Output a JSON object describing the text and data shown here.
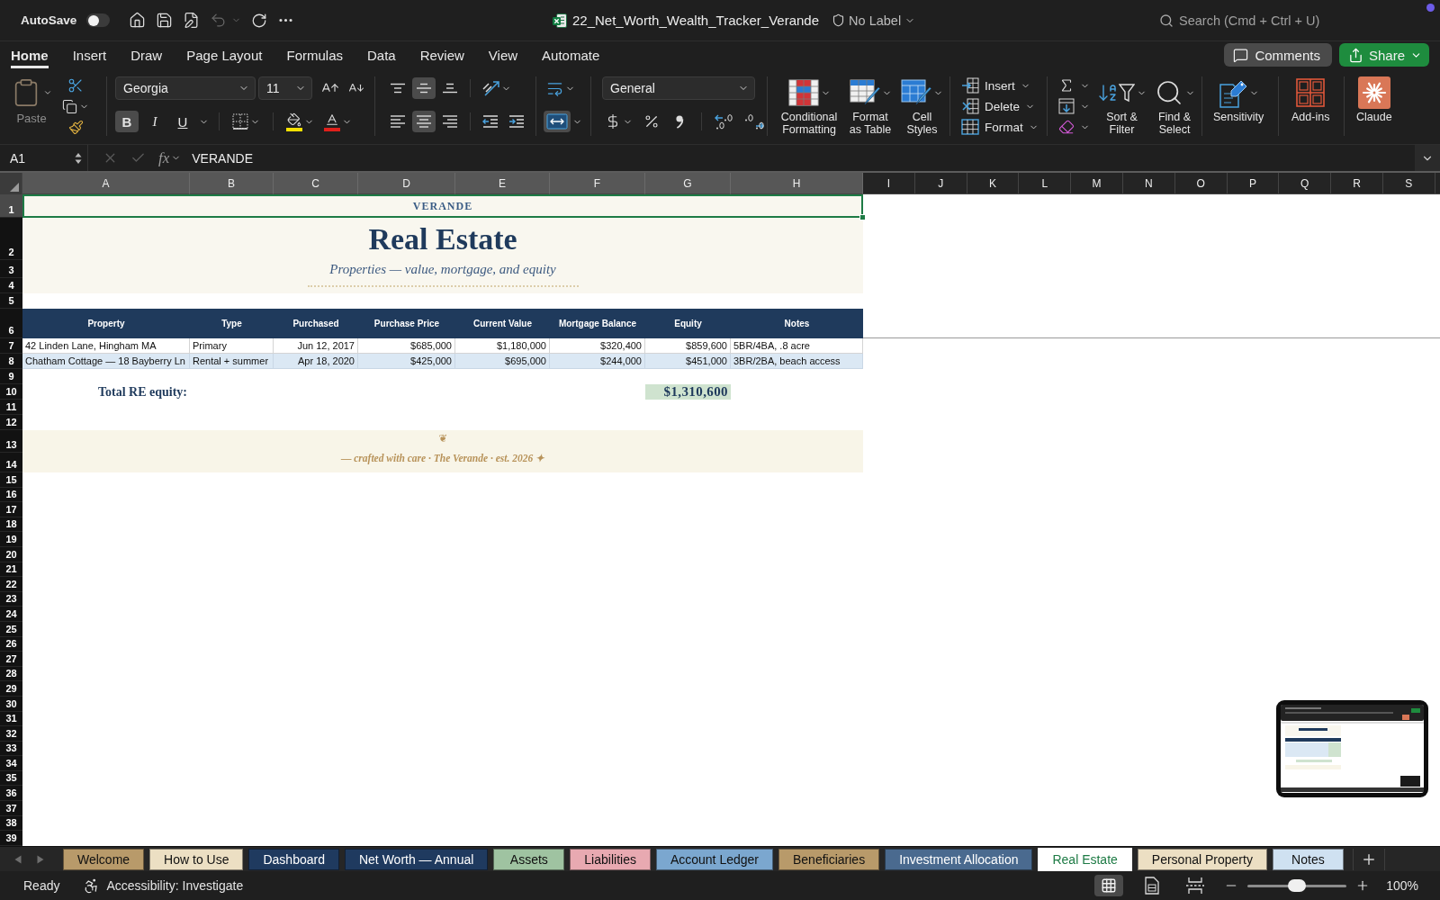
{
  "title_bar": {
    "autosave": {
      "label": "AutoSave",
      "on": false
    },
    "undo": {
      "disabled": true
    },
    "document_title": "22_Net_Worth_Wealth_Tracker_Verande",
    "sensitivity_label": "No Label",
    "search": {
      "placeholder": "Search (Cmd + Ctrl + U)"
    }
  },
  "ribbon": {
    "tabs": [
      {
        "label": "Home",
        "selected": true
      },
      {
        "label": "Insert",
        "selected": false
      },
      {
        "label": "Draw",
        "selected": false
      },
      {
        "label": "Page Layout",
        "selected": false
      },
      {
        "label": "Formulas",
        "selected": false
      },
      {
        "label": "Data",
        "selected": false
      },
      {
        "label": "Review",
        "selected": false
      },
      {
        "label": "View",
        "selected": false
      },
      {
        "label": "Automate",
        "selected": false
      }
    ],
    "comments_button": "Comments",
    "share_button": "Share",
    "paste": {
      "label": "Paste",
      "disabled": true
    },
    "font": {
      "name": "Georgia",
      "size": "11"
    },
    "text_styles": [
      {
        "kind": "bold",
        "label": "B",
        "on": true
      },
      {
        "kind": "italic",
        "label": "I",
        "on": false
      },
      {
        "kind": "underline",
        "label": "U",
        "on": false
      }
    ],
    "vertical_alignment": [
      {
        "kind": "top",
        "selected": false
      },
      {
        "kind": "middle",
        "selected": true
      },
      {
        "kind": "bottom",
        "selected": false
      }
    ],
    "horizontal_alignment": [
      {
        "kind": "left",
        "selected": false
      },
      {
        "kind": "center",
        "selected": true
      },
      {
        "kind": "right",
        "selected": false
      }
    ],
    "merge_and_center": {
      "on": true
    },
    "number_format": "General",
    "style_commands": [
      {
        "kind": "conditional_formatting",
        "label": "Conditional Formatting"
      },
      {
        "kind": "format_as_table",
        "label": "Format as Table"
      },
      {
        "kind": "cell_styles",
        "label": "Cell Styles"
      }
    ],
    "cell_commands": [
      {
        "kind": "insert",
        "label": "Insert"
      },
      {
        "kind": "delete",
        "label": "Delete"
      },
      {
        "kind": "format",
        "label": "Format"
      }
    ],
    "editing_commands": [
      {
        "kind": "sort_filter",
        "label": "Sort & Filter"
      },
      {
        "kind": "find_select",
        "label": "Find & Select"
      }
    ],
    "extra_commands": [
      {
        "kind": "sensitivity",
        "label": "Sensitivity"
      },
      {
        "kind": "add_ins",
        "label": "Add-ins"
      },
      {
        "kind": "claude",
        "label": "Claude"
      }
    ]
  },
  "formula_bar": {
    "name_box": "A1",
    "function_button": "fx",
    "formula": "VERANDE",
    "edit_buttons_disabled": true
  },
  "sheet": {
    "column_headers": [
      "A",
      "B",
      "C",
      "D",
      "E",
      "F",
      "G",
      "H",
      "I",
      "J",
      "K",
      "L",
      "M",
      "N",
      "O",
      "P",
      "Q",
      "R",
      "S"
    ],
    "row_numbers": [
      "1",
      "2",
      "3",
      "4",
      "5",
      "6",
      "7",
      "8",
      "9",
      "10",
      "11",
      "12",
      "13",
      "14",
      "15",
      "16",
      "17",
      "18",
      "19",
      "20",
      "21",
      "22",
      "23",
      "24",
      "25",
      "26",
      "27",
      "28",
      "29",
      "30",
      "31",
      "32",
      "33",
      "34",
      "35",
      "36",
      "37",
      "38",
      "39"
    ],
    "brand": {
      "text": "VERANDE",
      "selected": true
    },
    "title": "Real Estate",
    "subtitle": "Properties — value, mortgage, and equity",
    "table": {
      "columns": [
        "Property",
        "Type",
        "Purchased",
        "Purchase Price",
        "Current Value",
        "Mortgage Balance",
        "Equity",
        "Notes"
      ],
      "rows": [
        [
          "42 Linden Lane, Hingham MA",
          "Primary",
          "Jun 12, 2017",
          "$685,000",
          "$1,180,000",
          "$320,400",
          "$859,600",
          "5BR/4BA, .8 acre"
        ],
        [
          "Chatham Cottage — 18 Bayberry Ln",
          "Rental + summer",
          "Apr 18, 2020",
          "$425,000",
          "$695,000",
          "$244,000",
          "$451,000",
          "3BR/2BA, beach access"
        ]
      ]
    },
    "total": {
      "label": "Total RE equity:",
      "value": "$1,310,600"
    },
    "footer": {
      "ornament": "❦",
      "text": "— crafted with care · The Verande · est. 2026 ✦"
    }
  },
  "sheet_tabs": [
    {
      "label": "Welcome",
      "color": "#b89a6a",
      "selected": false
    },
    {
      "label": "How to Use",
      "color": "#ecdfc3",
      "selected": false
    },
    {
      "label": "Dashboard",
      "color": "#1f3a5f",
      "selected": false
    },
    {
      "label": "Net Worth — Annual",
      "color": "#1f3a5f",
      "selected": false
    },
    {
      "label": "Assets",
      "color": "#9fc3a1",
      "selected": false
    },
    {
      "label": "Liabilities",
      "color": "#e8a9b1",
      "selected": false
    },
    {
      "label": "Account Ledger",
      "color": "#7ba7cf",
      "selected": false
    },
    {
      "label": "Beneficiaries",
      "color": "#b89a6a",
      "selected": false
    },
    {
      "label": "Investment Allocation",
      "color": "#4a6a8f",
      "selected": false
    },
    {
      "label": "Real Estate",
      "selected": true
    },
    {
      "label": "Personal Property",
      "color": "#ecdfc3",
      "selected": false
    },
    {
      "label": "Notes",
      "color": "#cfe1f1",
      "selected": false
    }
  ],
  "status_bar": {
    "status": "Ready",
    "accessibility": "Accessibility: Investigate",
    "views": [
      {
        "kind": "normal",
        "selected": true
      },
      {
        "kind": "page_layout",
        "selected": false
      },
      {
        "kind": "page_break_preview",
        "selected": false
      }
    ],
    "zoom": {
      "level": 0.5
    },
    "zoom_label": "100%"
  }
}
